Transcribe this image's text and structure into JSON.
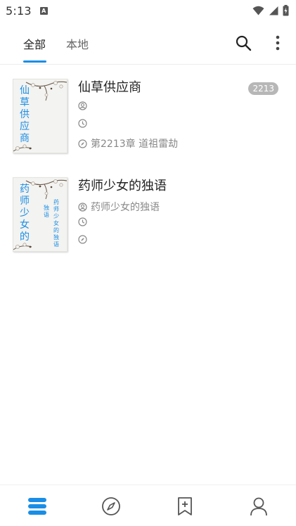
{
  "status_bar": {
    "time": "5:13",
    "notification_icon_letter": "A",
    "icons": [
      "wifi-icon",
      "signal-icon",
      "battery-charging-icon"
    ]
  },
  "tabs": {
    "all": "全部",
    "local": "本地",
    "active": "all"
  },
  "toolbar": {
    "icons": [
      "search-icon",
      "more-vertical-icon"
    ]
  },
  "books": [
    {
      "title": "仙草供应商",
      "cover_title": "仙草供应商",
      "badge": "2213",
      "author": "",
      "update_time": "",
      "latest_chapter": "第2213章 道祖雷劫"
    },
    {
      "title": "药师少女的独语",
      "cover_title": "药师少女的",
      "cover_sub_a": "独语",
      "cover_sub_b": "药师少女的独语",
      "badge": "",
      "author": "药师少女的独语",
      "update_time": "",
      "latest_chapter": ""
    }
  ],
  "bottom_nav": {
    "items": [
      "bookshelf-icon",
      "compass-icon",
      "bookmark-add-icon",
      "person-icon"
    ],
    "active": "bookshelf-icon"
  },
  "colors": {
    "accent": "#1a8ee6",
    "nav_inactive": "#555555",
    "meta_text": "#888888",
    "badge_bg": "#b7b7b7"
  }
}
